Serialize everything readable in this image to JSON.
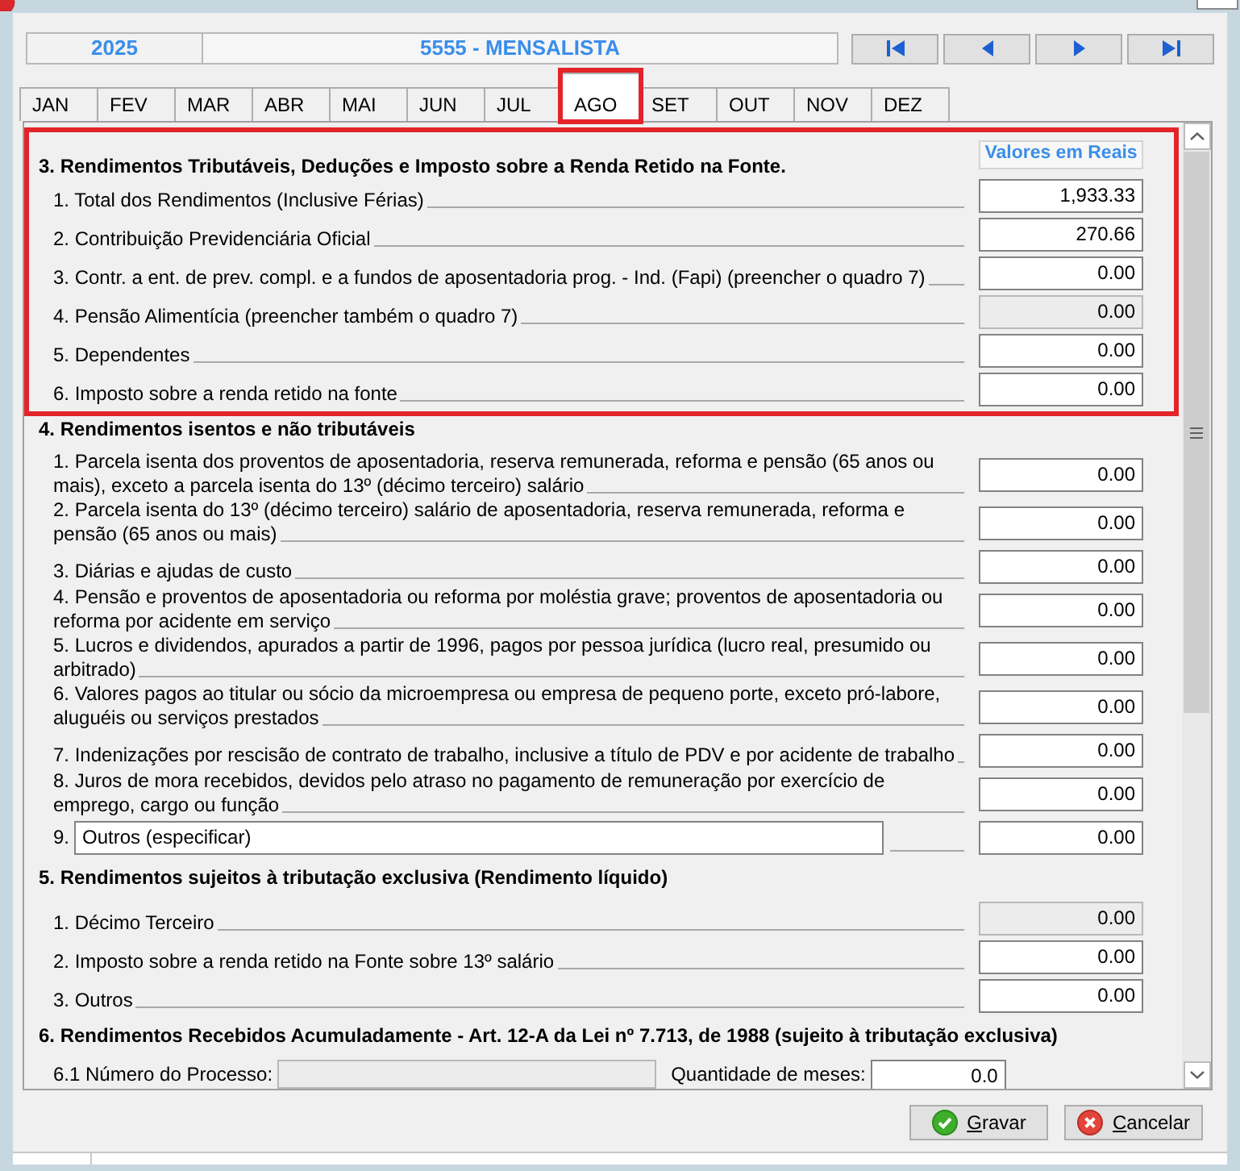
{
  "header": {
    "year": "2025",
    "employee": "5555 - MENSALISTA"
  },
  "nav_buttons": [
    {
      "kind": "first"
    },
    {
      "kind": "previous"
    },
    {
      "kind": "next"
    },
    {
      "kind": "last"
    }
  ],
  "tabs": [
    {
      "label": "JAN",
      "selected": false,
      "highlighted": false
    },
    {
      "label": "FEV",
      "selected": false,
      "highlighted": false
    },
    {
      "label": "MAR",
      "selected": false,
      "highlighted": false
    },
    {
      "label": "ABR",
      "selected": false,
      "highlighted": false
    },
    {
      "label": "MAI",
      "selected": false,
      "highlighted": false
    },
    {
      "label": "JUN",
      "selected": false,
      "highlighted": false
    },
    {
      "label": "JUL",
      "selected": false,
      "highlighted": false
    },
    {
      "label": "AGO",
      "selected": true,
      "highlighted": true
    },
    {
      "label": "SET",
      "selected": false,
      "highlighted": false
    },
    {
      "label": "OUT",
      "selected": false,
      "highlighted": false
    },
    {
      "label": "NOV",
      "selected": false,
      "highlighted": false
    },
    {
      "label": "DEZ",
      "selected": false,
      "highlighted": false
    }
  ],
  "sections": [
    {
      "title": "3. Rendimentos Tributáveis, Deduções e Imposto sobre a Renda Retido na Fonte.",
      "column_header": "Valores em Reais",
      "highlighted": true,
      "rows": [
        {
          "kind": "amount",
          "label": "1. Total dos Rendimentos (Inclusive Férias)",
          "value": "1,933.33",
          "disabled": false
        },
        {
          "kind": "amount",
          "label": "2. Contribuição Previdenciária Oficial",
          "value": "270.66",
          "disabled": false
        },
        {
          "kind": "amount",
          "label": "3. Contr. a ent. de prev. compl. e a fundos de aposentadoria prog. - Ind. (Fapi) (preencher o quadro 7)",
          "value": "0.00",
          "disabled": false
        },
        {
          "kind": "amount",
          "label": "4. Pensão Alimentícia (preencher também o quadro 7)",
          "value": "0.00",
          "disabled": true
        },
        {
          "kind": "amount",
          "label": "5. Dependentes",
          "value": "0.00",
          "disabled": false
        },
        {
          "kind": "amount",
          "label": "6. Imposto sobre a renda retido na fonte",
          "value": "0.00",
          "disabled": false
        }
      ]
    },
    {
      "title": "4. Rendimentos isentos e não tributáveis",
      "highlighted": false,
      "rows": [
        {
          "kind": "amount",
          "label": "1. Parcela isenta dos proventos de aposentadoria, reserva remunerada, reforma e pensão (65 anos ou mais), exceto a parcela isenta do 13º (décimo terceiro) salário",
          "value": "0.00",
          "disabled": false
        },
        {
          "kind": "amount",
          "label": "2. Parcela isenta do 13º (décimo terceiro) salário de aposentadoria, reserva remunerada, reforma e pensão (65 anos ou mais)",
          "value": "0.00",
          "disabled": false
        },
        {
          "kind": "amount",
          "label": "3. Diárias e ajudas de custo",
          "value": "0.00",
          "disabled": false
        },
        {
          "kind": "amount",
          "label": "4. Pensão e proventos de aposentadoria ou reforma por moléstia grave; proventos de aposentadoria ou reforma por acidente em serviço",
          "value": "0.00",
          "disabled": false
        },
        {
          "kind": "amount",
          "label": "5. Lucros e dividendos, apurados a partir de 1996, pagos por pessoa jurídica (lucro real, presumido ou arbitrado)",
          "value": "0.00",
          "disabled": false
        },
        {
          "kind": "amount",
          "label": "6. Valores pagos ao titular ou sócio da microempresa ou empresa de pequeno porte, exceto pró-labore, aluguéis ou serviços prestados",
          "value": "0.00",
          "disabled": false
        },
        {
          "kind": "amount",
          "label": "7. Indenizações por rescisão de contrato de trabalho, inclusive a título de PDV e por acidente de trabalho",
          "value": "0.00",
          "disabled": false
        },
        {
          "kind": "amount",
          "label": "8. Juros de mora recebidos, devidos pelo atraso no pagamento de remuneração por exercício de emprego, cargo ou função",
          "value": "0.00",
          "disabled": false
        },
        {
          "kind": "other",
          "number": "9.",
          "description": "Outros (especificar)",
          "value": "0.00",
          "disabled": false
        }
      ]
    },
    {
      "title": "5. Rendimentos sujeitos à tributação exclusiva (Rendimento líquido)",
      "highlighted": false,
      "rows": [
        {
          "kind": "amount",
          "label": "1. Décimo Terceiro",
          "value": "0.00",
          "disabled": true
        },
        {
          "kind": "amount",
          "label": "2. Imposto sobre a renda retido na Fonte sobre 13º salário",
          "value": "0.00",
          "disabled": false
        },
        {
          "kind": "amount",
          "label": "3. Outros",
          "value": "0.00",
          "disabled": false
        }
      ]
    },
    {
      "title": "6. Rendimentos Recebidos Acumuladamente - Art. 12-A da Lei nº 7.713, de 1988 (sujeito à tributação exclusiva)",
      "highlighted": false,
      "rows": [
        {
          "kind": "process",
          "label": "6.1 Número do Processo:",
          "disabled": true,
          "months_label": "Quantidade de meses:",
          "months_value": "0.0"
        }
      ]
    }
  ],
  "buttons": [
    {
      "kind": "save",
      "label": "Gravar"
    },
    {
      "kind": "cancel",
      "label": "Cancelar"
    }
  ]
}
